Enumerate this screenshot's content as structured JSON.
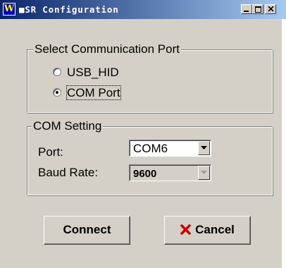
{
  "window": {
    "title": "■SR Configuration",
    "app_icon_letter": "W"
  },
  "port_group": {
    "legend": "Select Communication Port",
    "options": [
      {
        "label": "USB_HID",
        "selected": false
      },
      {
        "label": "COM Port",
        "selected": true
      }
    ]
  },
  "com_setting": {
    "legend": "COM Setting",
    "port_label": "Port:",
    "port_value": "COM6",
    "baud_label": "Baud Rate:",
    "baud_value": "9600"
  },
  "buttons": {
    "connect_label": "Connect",
    "cancel_label": "Cancel"
  },
  "colors": {
    "title_start": "#0a246a",
    "title_end": "#a6caf0",
    "face": "#d4d0c8",
    "cancel_x": "#cc0000"
  },
  "icons": {
    "app": "w-app-icon",
    "minimize": "minimize-icon",
    "maximize": "maximize-icon",
    "close": "close-icon",
    "cancel": "red-x-icon",
    "dropdown": "chevron-down-icon"
  }
}
